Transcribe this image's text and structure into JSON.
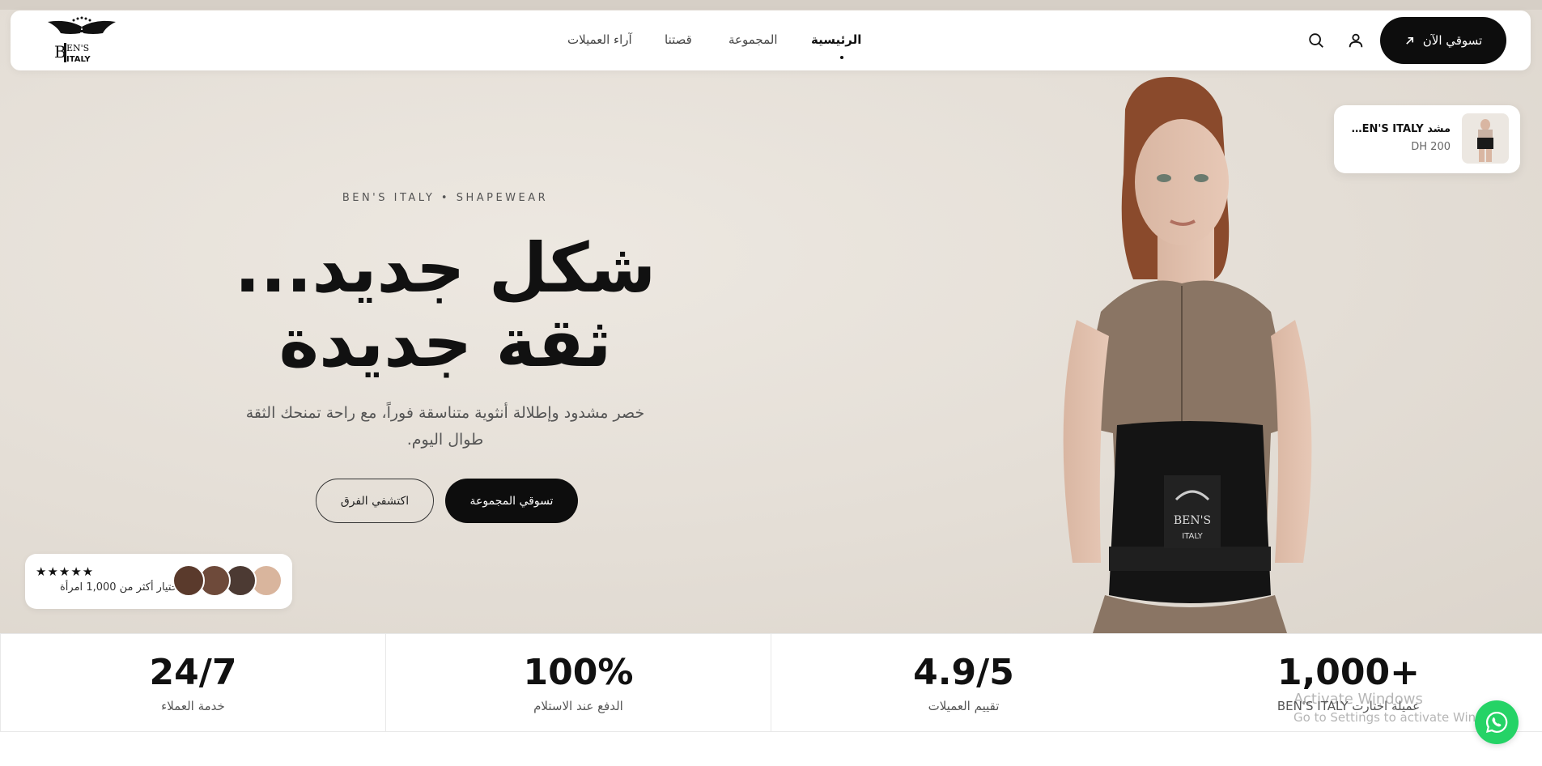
{
  "brand": {
    "logo_top": "BEN'S",
    "logo_bottom": "ITALY"
  },
  "nav": {
    "links": [
      {
        "label": "الرئيسية",
        "active": true
      },
      {
        "label": "المجموعة"
      },
      {
        "label": "قصتنا"
      },
      {
        "label": "آراء العميلات"
      }
    ],
    "search_icon": "search-icon",
    "account_icon": "user-icon",
    "shop_now_label": "تسوقي الآن"
  },
  "hero": {
    "eyebrow": "BEN'S ITALY • SHAPEWEAR",
    "headline_line1": "شكل جديد...",
    "headline_line2": "ثقة جديدة",
    "subtext": "خصر مشدود وإطلالة أنثوية متناسقة فوراً، مع راحة تمنحك الثقة طوال اليوم.",
    "primary_button": "تسوقي المجموعة",
    "secondary_button": "اكتشفي الفرق"
  },
  "social_proof": {
    "stars": "★★★★★",
    "rating_stars": 5,
    "text": "اختيار أكثر من 1,000 امرأة"
  },
  "mini_product": {
    "name": "مشد BEN'S ITALY الك...",
    "price": "DH 200"
  },
  "stats": [
    {
      "value": "1,000+",
      "label": "عميلة اختارت BEN'S ITALY"
    },
    {
      "value": "4.9/5",
      "label": "تقييم العميلات"
    },
    {
      "value": "100%",
      "label": "الدفع عند الاستلام"
    },
    {
      "value": "24/7",
      "label": "خدمة العملاء"
    }
  ],
  "os_overlay": {
    "title": "Activate Windows",
    "subtitle": "Go to Settings to activate Windows."
  },
  "whatsapp_icon": "whatsapp-icon",
  "colors": {
    "accent": "#0d0d0d",
    "hero_bg": "#e4ded6",
    "whatsapp": "#25d366"
  }
}
